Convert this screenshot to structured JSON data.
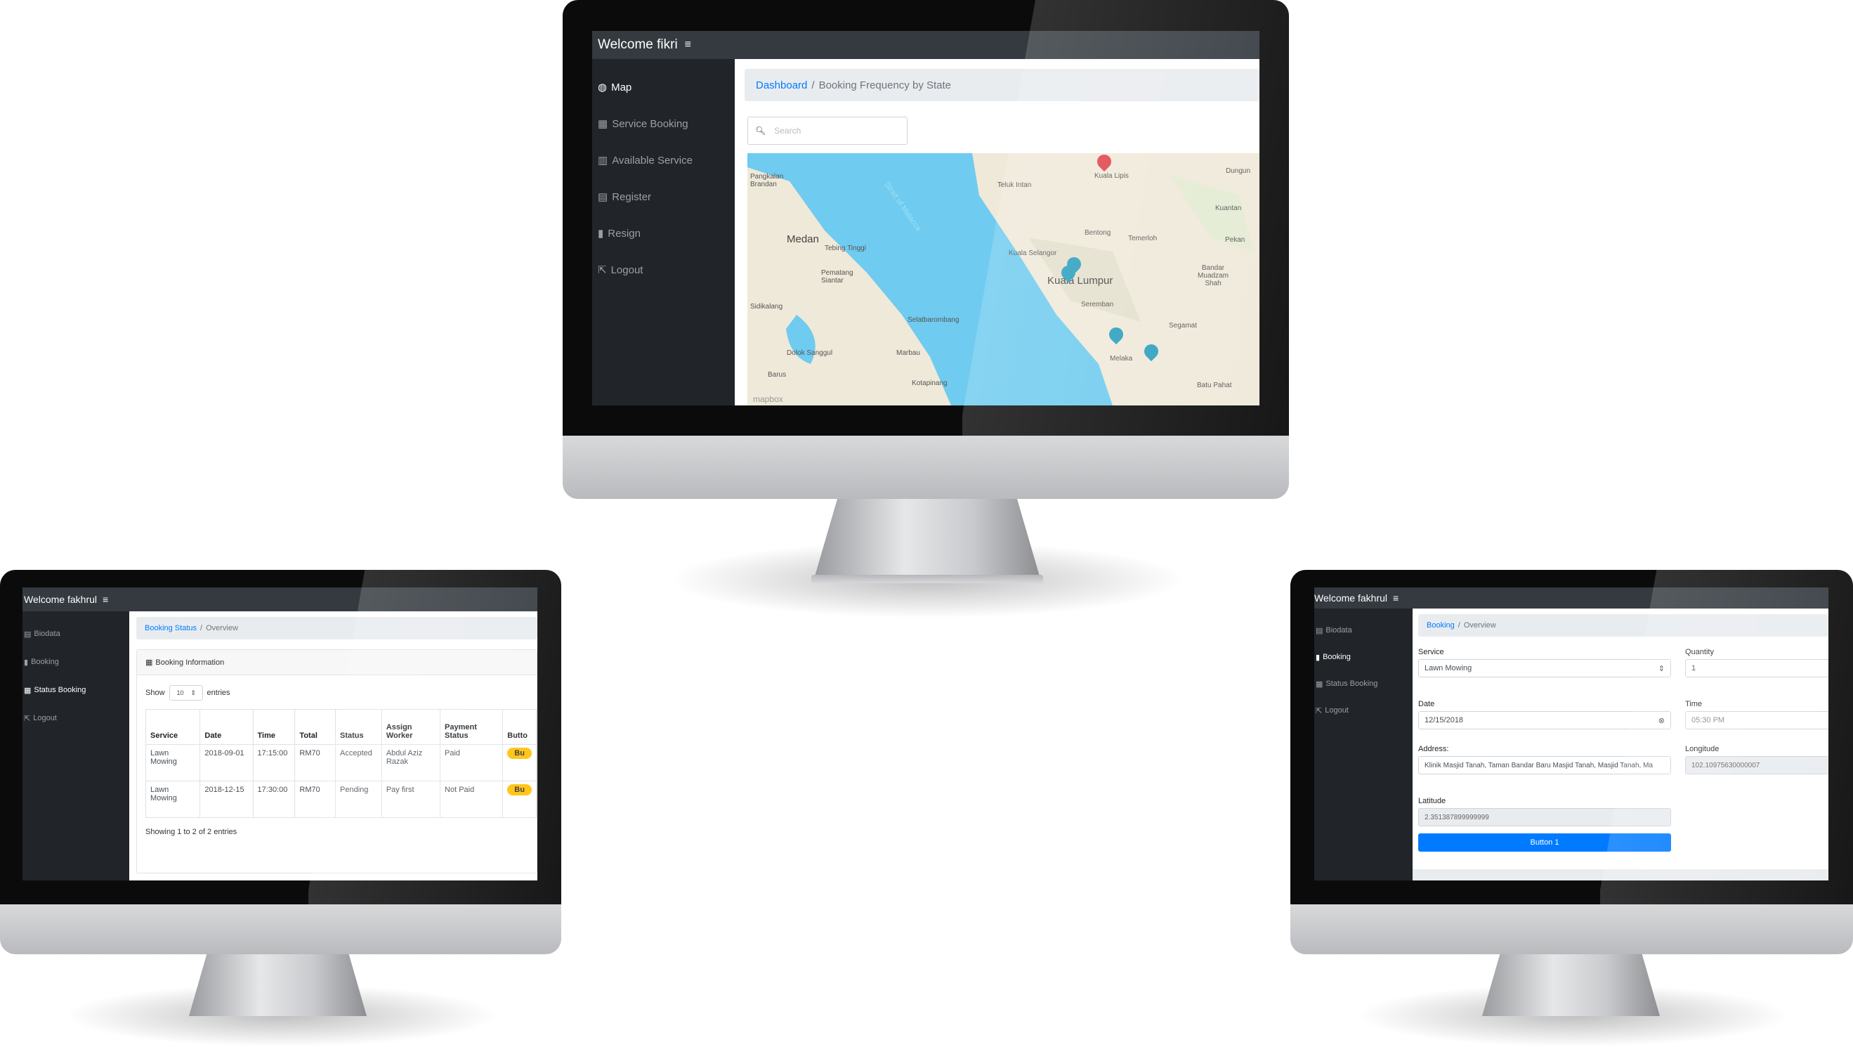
{
  "top_monitor": {
    "header": {
      "title": "Welcome fikri",
      "menu_icon": "hamburger-icon"
    },
    "sidebar": [
      {
        "label": "Map",
        "icon": "globe-icon",
        "active": true
      },
      {
        "label": "Service Booking",
        "icon": "table-icon"
      },
      {
        "label": "Available Service",
        "icon": "bar-chart-icon"
      },
      {
        "label": "Register",
        "icon": "id-card-icon"
      },
      {
        "label": "Resign",
        "icon": "file-icon"
      },
      {
        "label": "Logout",
        "icon": "logout-icon"
      }
    ],
    "breadcrumb": {
      "link": "Dashboard",
      "separator": "/",
      "current": "Booking Frequency by State"
    },
    "search": {
      "placeholder": "Search"
    },
    "map": {
      "sea_label": "Strait of Malacca",
      "places": [
        "Pangkalan Brandan",
        "Medan",
        "Tebing Tinggi",
        "Pematang Siantar",
        "Sidikalang",
        "Dolok Sanggul",
        "Marbau",
        "Kotapinang",
        "Selatbarombang",
        "Teluk Intan",
        "Bentong",
        "Temerloh",
        "Kuala Selangor",
        "Kuala Lumpur",
        "Seremban",
        "Segamat",
        "Melaka",
        "Batu Pahat",
        "Kuala Lipis",
        "Kuantan",
        "Dungun",
        "Pekan",
        "Bandar Muadzam Shah",
        "Barus"
      ],
      "attribution": "mapbox",
      "markers": {
        "red": 1,
        "teal": 4
      }
    }
  },
  "left_monitor": {
    "header": {
      "title": "Welcome fakhrul"
    },
    "sidebar": [
      {
        "label": "Biodata"
      },
      {
        "label": "Booking"
      },
      {
        "label": "Status Booking",
        "active": true
      },
      {
        "label": "Logout"
      }
    ],
    "breadcrumb": {
      "link": "Booking Status",
      "separator": "/",
      "current": "Overview"
    },
    "card_title": "Booking Information",
    "show": {
      "prefix": "Show",
      "value": "10",
      "suffix": "entries"
    },
    "columns": [
      "Service",
      "Date",
      "Time",
      "Total",
      "Status",
      "Assign Worker",
      "Payment Status",
      "Butto"
    ],
    "rows": [
      [
        "Lawn Mowing",
        "2018-09-01",
        "17:15:00",
        "RM70",
        "Accepted",
        "Abdul Aziz Razak",
        "Paid",
        "Bu"
      ],
      [
        "Lawn Mowing",
        "2018-12-15",
        "17:30:00",
        "RM70",
        "Pending",
        "Pay first",
        "Not Paid",
        "Bu"
      ]
    ],
    "footer": "Showing 1 to 2 of 2 entries",
    "button_color": "#ffc107"
  },
  "right_monitor": {
    "header": {
      "title": "Welcome fakhrul"
    },
    "sidebar": [
      {
        "label": "Biodata"
      },
      {
        "label": "Booking",
        "active": true
      },
      {
        "label": "Status Booking"
      },
      {
        "label": "Logout"
      }
    ],
    "breadcrumb": {
      "link": "Booking",
      "separator": "/",
      "current": "Overview"
    },
    "form": {
      "service_label": "Service",
      "service_value": "Lawn Mowing",
      "quantity_label": "Quantity",
      "quantity_value": "1",
      "date_label": "Date",
      "date_value": "12/15/2018",
      "time_label": "Time",
      "time_value": "05:30 PM",
      "address_label": "Address:",
      "address_value": "Klinik Masjid Tanah, Taman Bandar Baru Masjid Tanah, Masjid Tanah, Ma",
      "longitude_label": "Longitude",
      "longitude_value": "102.10975630000007",
      "latitude_label": "Latitude",
      "latitude_value": "2.351387899999999",
      "submit": "Button 1"
    },
    "accent": "#007bff"
  }
}
